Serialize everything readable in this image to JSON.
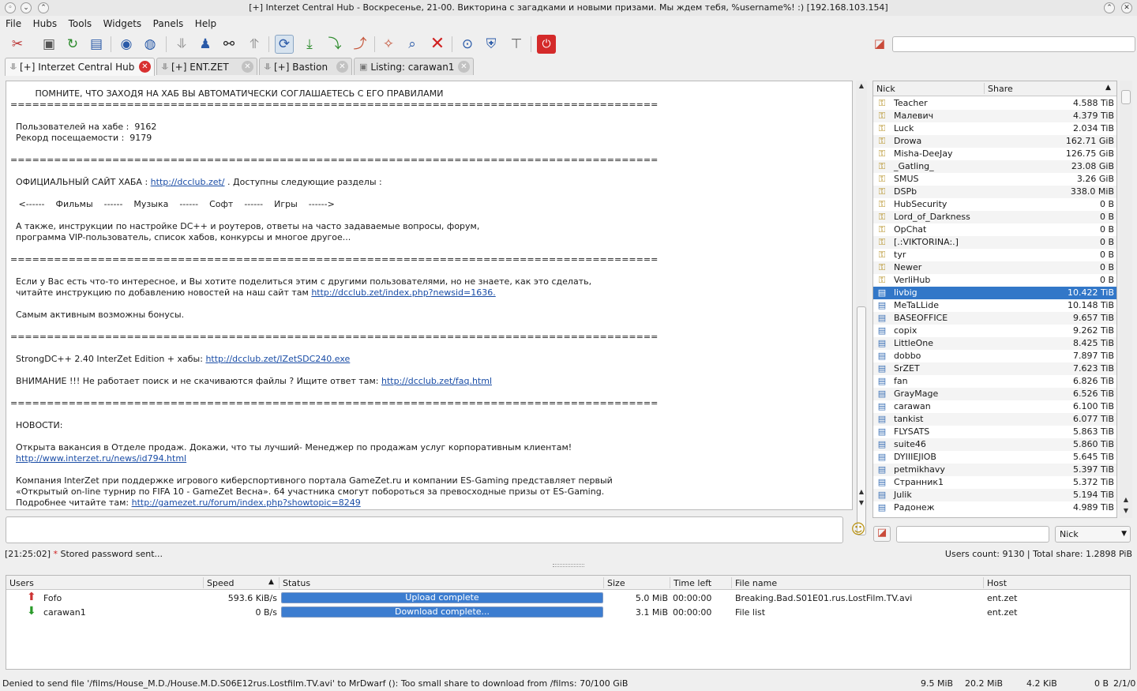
{
  "window": {
    "title": "[+] Interzet Central Hub -  Воскресенье, 21-00. Викторина с загадками и новыми призами. Мы ждем тебя, %username%! :) [192.168.103.154]"
  },
  "menu": [
    "File",
    "Hubs",
    "Tools",
    "Widgets",
    "Panels",
    "Help"
  ],
  "toolbar": {
    "icons": [
      "settings-icon",
      "public-hubs-icon",
      "reconnect-icon",
      "favorite-hubs-icon",
      "connect-icon",
      "favorite-users-icon",
      "download-queue-icon",
      "finished-downloads-icon",
      "search-icon",
      "finished-uploads-icon",
      "hub-icon",
      "download-icon",
      "upload-icon",
      "queue-icon",
      "clear-icon",
      "search-spy-icon",
      "close-icon",
      "adl-search-icon",
      "security-icon",
      "filter-icon",
      "quit-icon"
    ]
  },
  "tabs": [
    {
      "label": "[+] Interzet Central Hub",
      "active": true
    },
    {
      "label": "[+] ENT.ZET",
      "active": false
    },
    {
      "label": "[+] Bastion",
      "active": false
    },
    {
      "label": "Listing: carawan1",
      "active": false
    }
  ],
  "chat": {
    "lines": [
      {
        "text": "         ПОМНИТЕ, ЧТО ЗАХОДЯ НА ХАБ ВЫ АВТОМАТИЧЕСКИ СОГЛАШАЕТЕСЬ С ЕГО ПРАВИЛАМИ"
      },
      {
        "text": "========================================================================================="
      },
      {
        "text": ""
      },
      {
        "text": "  Пользователей на хабе :  9162"
      },
      {
        "text": "  Рекорд посещаемости :  9179"
      },
      {
        "text": ""
      },
      {
        "text": "========================================================================================="
      },
      {
        "text": ""
      },
      {
        "text": "  ОФИЦИАЛЬНЫЙ САЙТ ХАБА : ",
        "link": "http://dcclub.zet/",
        "after": " . Доступны следующие разделы :"
      },
      {
        "text": ""
      },
      {
        "text": "   <------    Фильмы    ------    Музыка    ------    Софт    ------    Игры    ------>"
      },
      {
        "text": ""
      },
      {
        "text": "  А также, инструкции по настройке DC++ и роутеров, ответы на часто задаваемые вопросы, форум,"
      },
      {
        "text": "  программа VIP-пользователь, список хабов, конкурсы и многое другое..."
      },
      {
        "text": ""
      },
      {
        "text": "========================================================================================="
      },
      {
        "text": ""
      },
      {
        "text": "  Если у Вас есть что-то интересное, и Вы хотите поделиться этим с другими пользователями, но не знаете, как это сделать,"
      },
      {
        "text": "  читайте инструкцию по добавлению новостей на наш сайт там ",
        "link": "http://dcclub.zet/index.php?newsid=1636.",
        "after": ""
      },
      {
        "text": ""
      },
      {
        "text": "  Самым активным возможны бонусы."
      },
      {
        "text": ""
      },
      {
        "text": "========================================================================================="
      },
      {
        "text": ""
      },
      {
        "text": "  StrongDC++ 2.40 InterZet Edition + хабы: ",
        "link": "http://dcclub.zet/IZetSDC240.exe",
        "after": ""
      },
      {
        "text": ""
      },
      {
        "text": "  ВНИМАНИЕ !!! Не работает поиск и не скачиваются файлы ? Ищите ответ там: ",
        "link": "http://dcclub.zet/faq.html",
        "after": ""
      },
      {
        "text": ""
      },
      {
        "text": "========================================================================================="
      },
      {
        "text": ""
      },
      {
        "text": "  НОВОСТИ:"
      },
      {
        "text": ""
      },
      {
        "text": "  Открыта вакансия в Отделе продаж. Докажи, что ты лучший- Менеджер по продажам услуг корпоративным клиентам!"
      },
      {
        "text": "  ",
        "link": "http://www.interzet.ru/news/id794.html",
        "after": ""
      },
      {
        "text": ""
      },
      {
        "text": "  Компания InterZet при поддержке игрового киберспортивного портала GameZet.ru и компании ES-Gaming представляет первый"
      },
      {
        "text": "  «Открытый on-line турнир по FIFA 10 - GameZet Весна». 64 участника смогут побороться за превосходные призы от ES-Gaming."
      },
      {
        "text": "  Подробнее читайте там: ",
        "link": "http://gamezet.ru/forum/index.php?showtopic=8249",
        "after": ""
      }
    ]
  },
  "users": {
    "columns": {
      "nick": "Nick",
      "share": "Share"
    },
    "rows": [
      {
        "nick": "Teacher",
        "share": "4.588 TiB",
        "op": true
      },
      {
        "nick": "Малевич",
        "share": "4.379 TiB",
        "op": true
      },
      {
        "nick": "Luck",
        "share": "2.034 TiB",
        "op": true
      },
      {
        "nick": "Drowa",
        "share": "162.71 GiB",
        "op": true
      },
      {
        "nick": "Misha-DeeJay",
        "share": "126.75 GiB",
        "op": true
      },
      {
        "nick": "_Gatling_",
        "share": "23.08 GiB",
        "op": true
      },
      {
        "nick": "SMUS",
        "share": "3.26 GiB",
        "op": true
      },
      {
        "nick": "DSPb",
        "share": "338.0 MiB",
        "op": true
      },
      {
        "nick": "HubSecurity",
        "share": "0 B",
        "op": true
      },
      {
        "nick": "Lord_of_Darkness",
        "share": "0 B",
        "op": true
      },
      {
        "nick": "OpChat",
        "share": "0 B",
        "op": true
      },
      {
        "nick": "[.:VIKTORINA:.]",
        "share": "0 B",
        "op": true
      },
      {
        "nick": "tyr",
        "share": "0 B",
        "op": true
      },
      {
        "nick": "Newer",
        "share": "0 B",
        "op": true
      },
      {
        "nick": "VerliHub",
        "share": "0 B",
        "op": true
      },
      {
        "nick": "livbig",
        "share": "10.422 TiB",
        "op": false,
        "selected": true
      },
      {
        "nick": "MeTaLLide",
        "share": "10.148 TiB",
        "op": false
      },
      {
        "nick": "BASEOFFICE",
        "share": "9.657 TiB",
        "op": false
      },
      {
        "nick": "copix",
        "share": "9.262 TiB",
        "op": false
      },
      {
        "nick": "LittleOne",
        "share": "8.425 TiB",
        "op": false
      },
      {
        "nick": "dobbo",
        "share": "7.897 TiB",
        "op": false
      },
      {
        "nick": "SrZET",
        "share": "7.623 TiB",
        "op": false
      },
      {
        "nick": "fan",
        "share": "6.826 TiB",
        "op": false
      },
      {
        "nick": "GrayMage",
        "share": "6.526 TiB",
        "op": false
      },
      {
        "nick": "carawan",
        "share": "6.100 TiB",
        "op": false
      },
      {
        "nick": "tankist",
        "share": "6.077 TiB",
        "op": false
      },
      {
        "nick": "FLYSATS",
        "share": "5.863 TiB",
        "op": false
      },
      {
        "nick": "suite46",
        "share": "5.860 TiB",
        "op": false
      },
      {
        "nick": "DYIIIEJIOB",
        "share": "5.645 TiB",
        "op": false
      },
      {
        "nick": "petmikhavy",
        "share": "5.397 TiB",
        "op": false
      },
      {
        "nick": "Странник1",
        "share": "5.372 TiB",
        "op": false
      },
      {
        "nick": "Julik",
        "share": "5.194 TiB",
        "op": false
      },
      {
        "nick": "Радонеж",
        "share": "4.989 TiB",
        "op": false
      }
    ],
    "filter_column": "Nick",
    "count_text": "Users count: 9130 | Total share: 1.2898 PiB"
  },
  "status_message": {
    "time": "[21:25:02]",
    "star": "*",
    "text": " Stored password sent..."
  },
  "transfers": {
    "columns": [
      "Users",
      "Speed",
      "Status",
      "Size",
      "Time left",
      "File name",
      "Host"
    ],
    "rows": [
      {
        "user": "Fofo",
        "direction": "upload",
        "speed": "593.6 KiB/s",
        "status": "Upload complete",
        "progress": 1.0,
        "size": "5.0 MiB",
        "time_left": "00:00:00",
        "file": "Breaking.Bad.S01E01.rus.LostFilm.TV.avi",
        "host": "ent.zet"
      },
      {
        "user": "carawan1",
        "direction": "download",
        "speed": "0 B/s",
        "status": "Download complete...",
        "progress": 1.0,
        "size": "3.1 MiB",
        "time_left": "00:00:00",
        "file": "File list",
        "host": "ent.zet"
      }
    ]
  },
  "statusbar": {
    "message": "Denied to send file '/films/House_M.D./House.M.D.S06E12rus.Lostfilm.TV.avi' to MrDwarf (): Too small share to download from /films: 70/100 GiB",
    "down_total": "9.5 MiB",
    "up_total": "20.2 MiB",
    "speed": "4.2 KiB",
    "rate": "0 B",
    "slots": "2/1/0"
  },
  "colors": {
    "selection": "#3277c8",
    "progress": "#3c7dd0",
    "link": "#1a4da6"
  }
}
